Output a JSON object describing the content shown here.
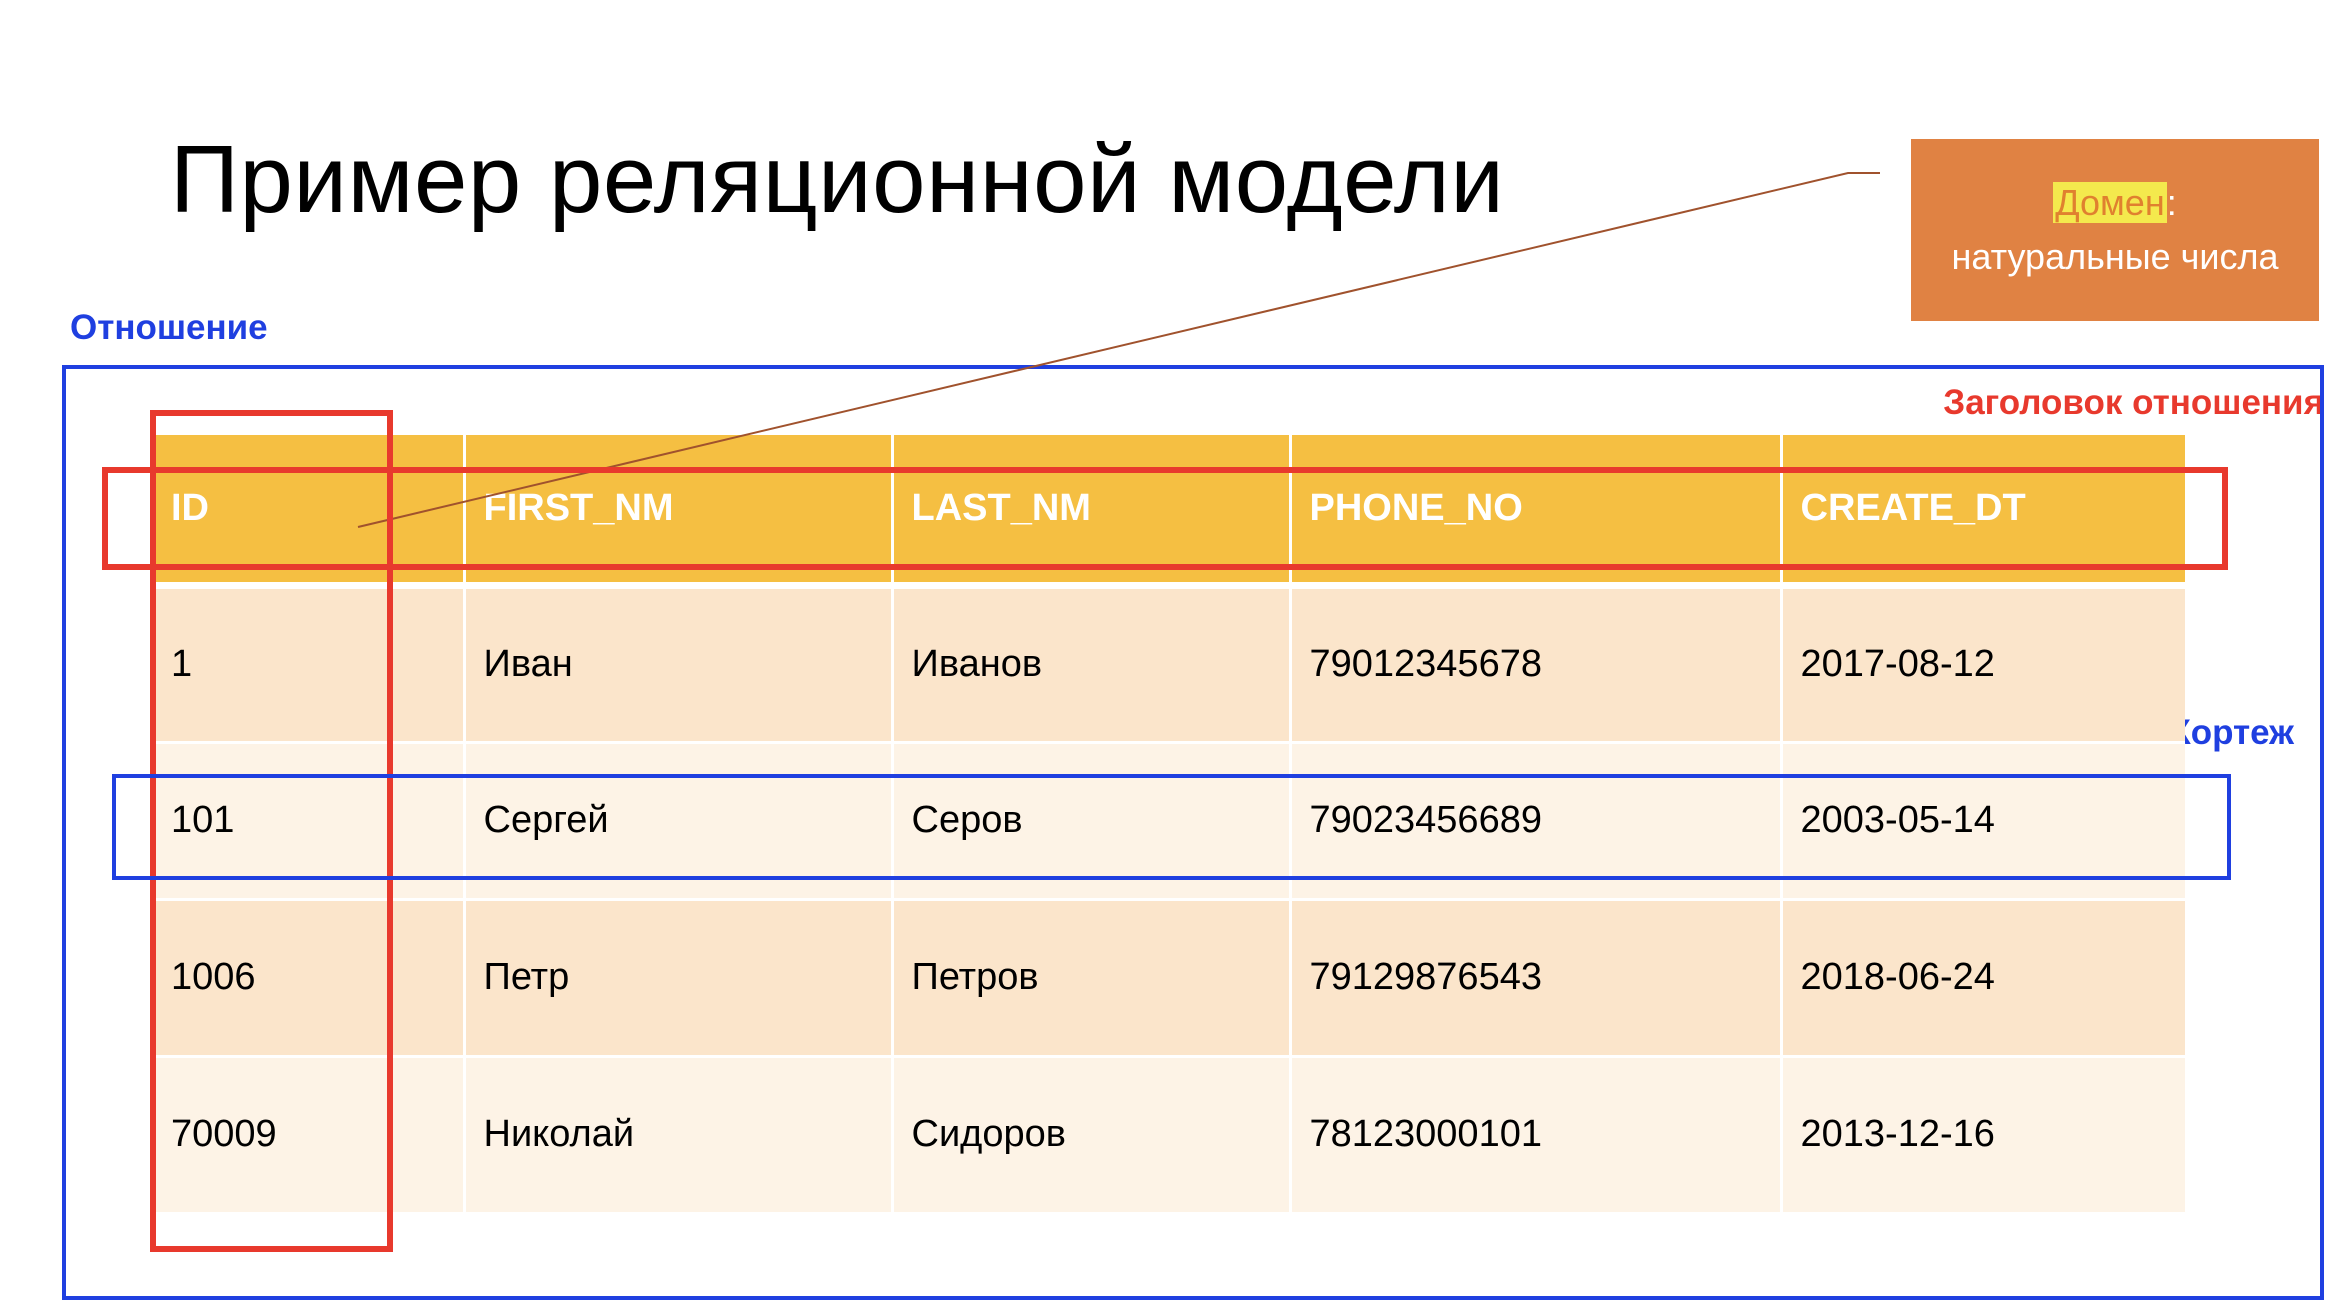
{
  "title": "Пример реляционной модели",
  "domain_box": {
    "term": "Домен",
    "colon": ":",
    "description": "натуральные числа"
  },
  "labels": {
    "relation": "Отношение",
    "relation_header": "Заголовок отношения",
    "tuple": "Кортеж"
  },
  "table": {
    "columns": [
      "ID",
      "FIRST_NM",
      "LAST_NM",
      "PHONE_NO",
      "CREATE_DT"
    ],
    "rows": [
      [
        "1",
        "Иван",
        "Иванов",
        "79012345678",
        "2017-08-12"
      ],
      [
        "101",
        "Сергей",
        "Серов",
        "79023456689",
        "2003-05-14"
      ],
      [
        "1006",
        "Петр",
        "Петров",
        "79129876543",
        "2018-06-24"
      ],
      [
        "70009",
        "Николай",
        "Сидоров",
        "78123000101",
        "2013-12-16"
      ]
    ]
  },
  "colors": {
    "header_fill": "#f5bf42",
    "row_dark": "#fbe5cb",
    "row_light": "#fdf3e6",
    "blue_frame": "#1f3fe0",
    "red_frame": "#e8392d",
    "domain_fill": "#e08243",
    "connector": "#a0522d"
  }
}
